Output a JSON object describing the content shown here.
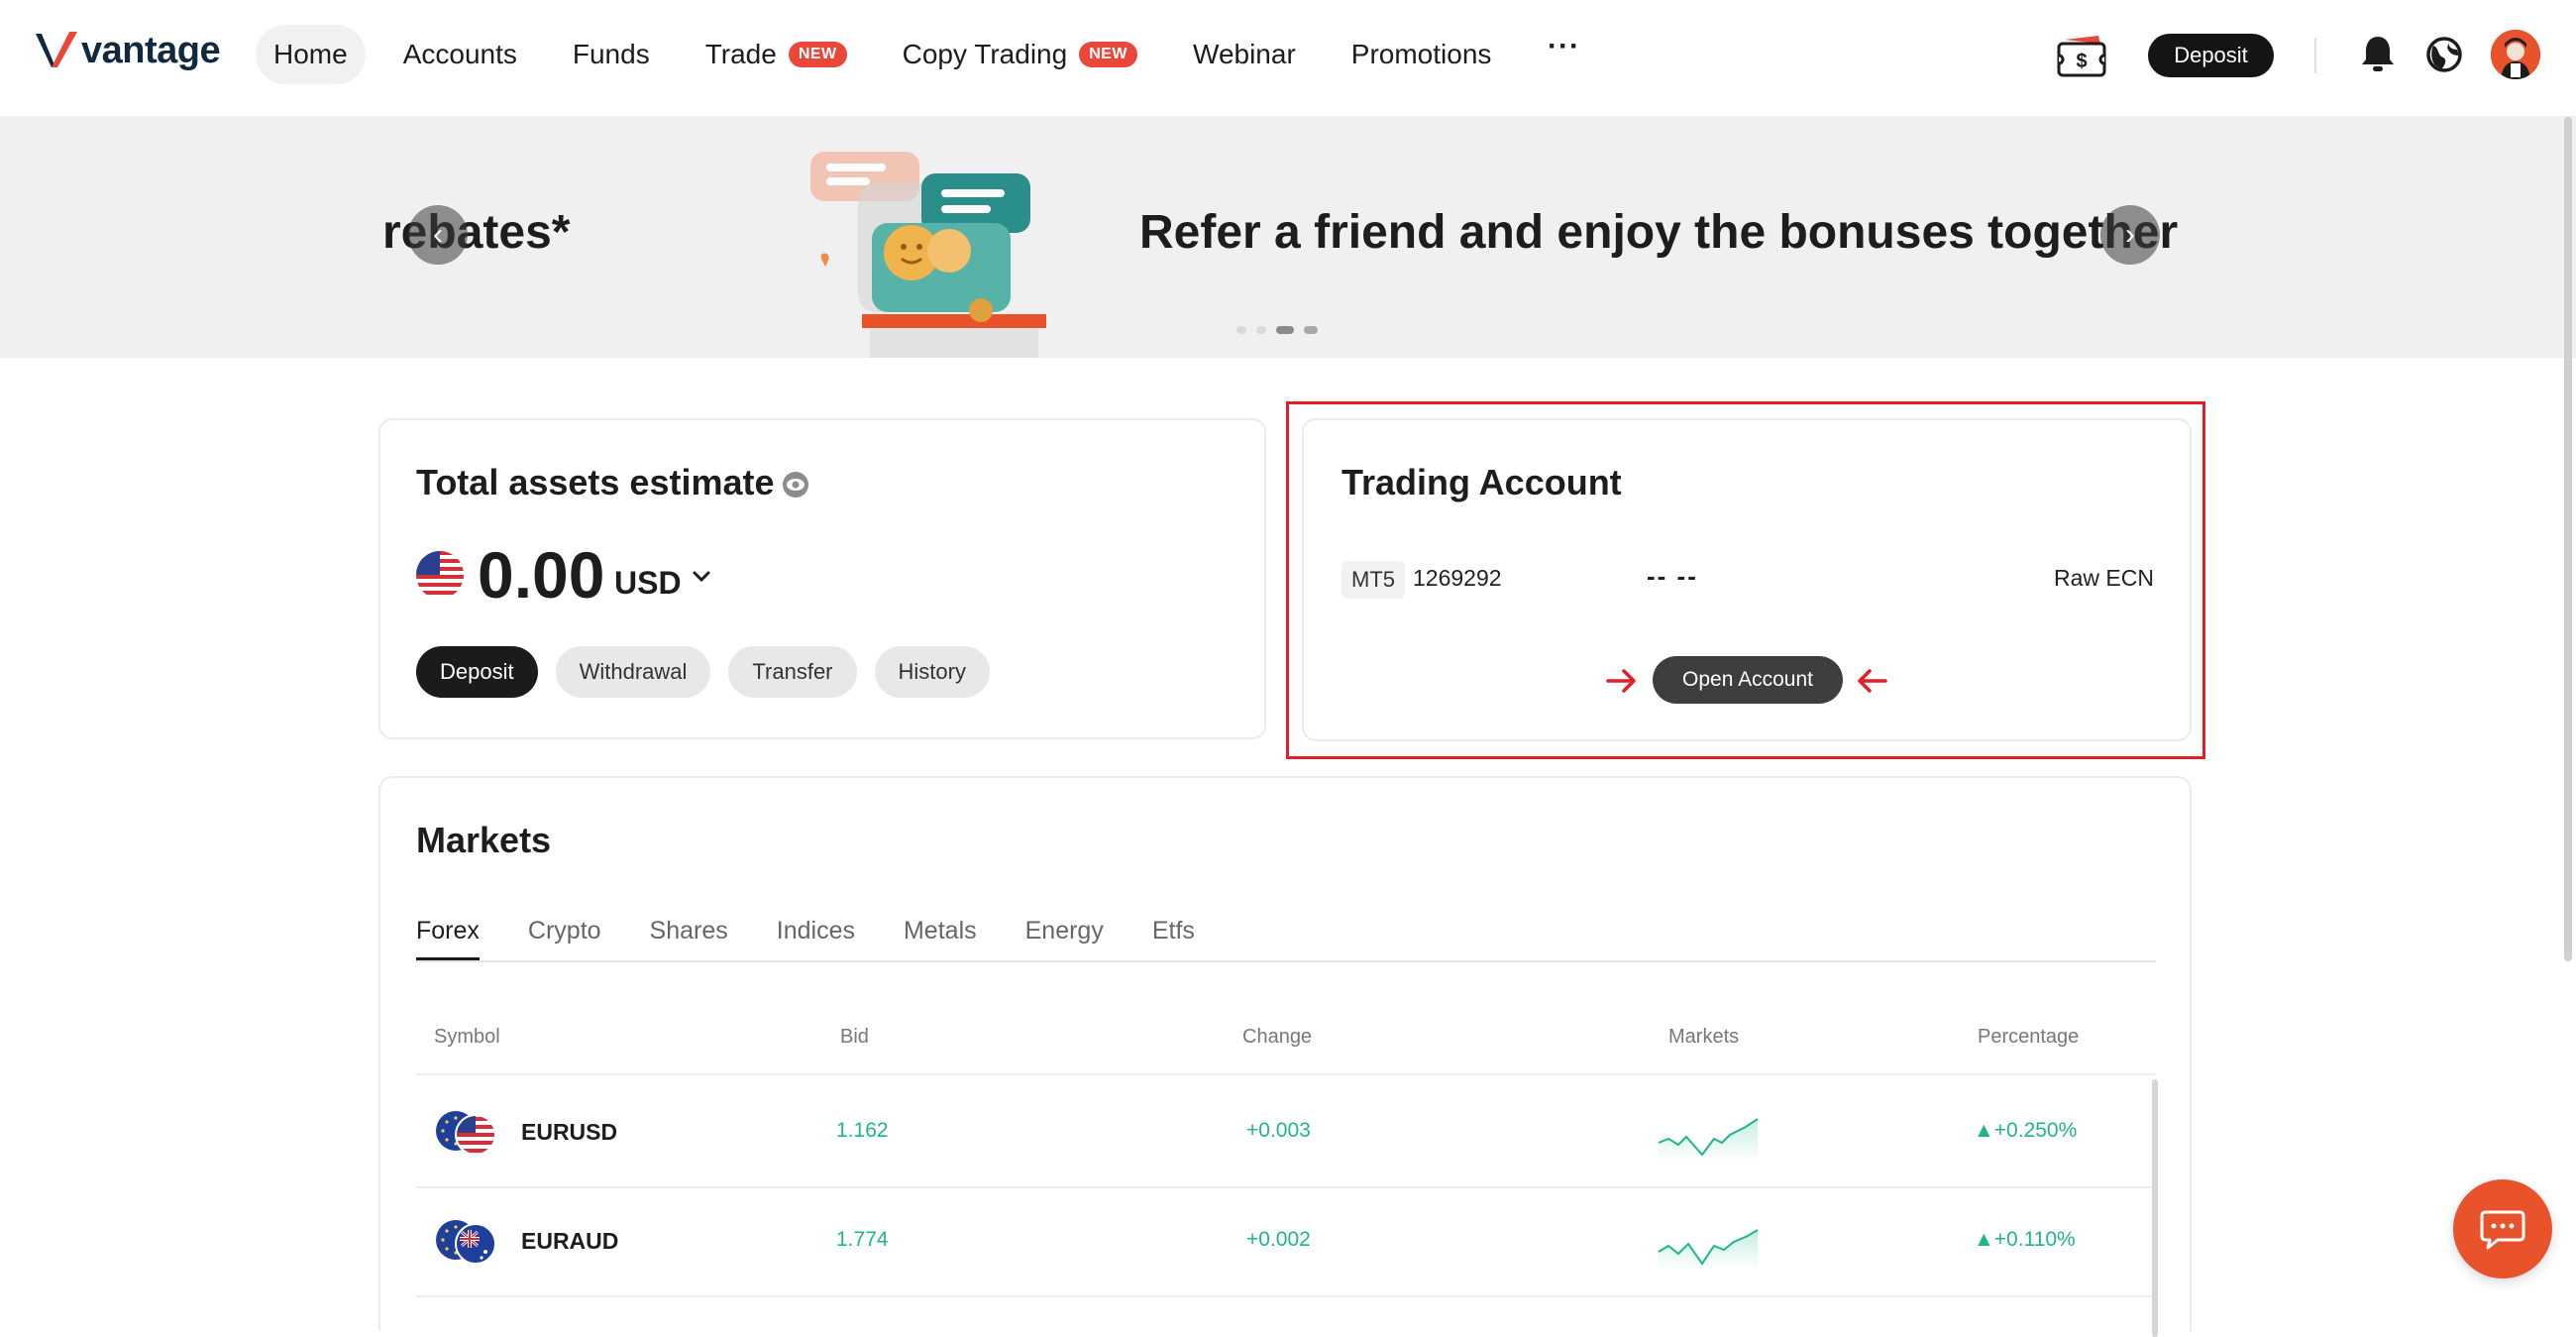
{
  "brand": {
    "name": "vantage",
    "accent": "#e8473a",
    "logo_color": "#11293f"
  },
  "nav": {
    "items": [
      {
        "label": "Home",
        "active": true
      },
      {
        "label": "Accounts"
      },
      {
        "label": "Funds"
      },
      {
        "label": "Trade",
        "badge": "NEW"
      },
      {
        "label": "Copy Trading",
        "badge": "NEW"
      },
      {
        "label": "Webinar"
      },
      {
        "label": "Promotions"
      }
    ],
    "more": "···",
    "deposit_label": "Deposit"
  },
  "banner": {
    "left_text": "rebates*",
    "main_text": "Refer a friend and enjoy the bonuses together",
    "dots": 4,
    "active_dot": 3
  },
  "assets": {
    "title": "Total assets estimate",
    "amount": "0.00",
    "currency": "USD",
    "buttons": [
      "Deposit",
      "Withdrawal",
      "Transfer",
      "History"
    ]
  },
  "trading_account": {
    "title": "Trading Account",
    "platform": "MT5",
    "account_number": "1269292",
    "values": "-- --",
    "account_type": "Raw ECN",
    "open_label": "Open Account",
    "highlight_color": "#e41e26"
  },
  "markets": {
    "title": "Markets",
    "tabs": [
      "Forex",
      "Crypto",
      "Shares",
      "Indices",
      "Metals",
      "Energy",
      "Etfs"
    ],
    "active_tab": "Forex",
    "columns": [
      "Symbol",
      "Bid",
      "Change",
      "Markets",
      "Percentage"
    ],
    "rows": [
      {
        "symbol": "EURUSD",
        "bid": "1.162",
        "change": "+0.003",
        "percentage": "+0.250%"
      },
      {
        "symbol": "EURAUD",
        "bid": "1.774",
        "change": "+0.002",
        "percentage": "+0.110%"
      }
    ],
    "positive_color": "#1fb58c"
  },
  "chat": {
    "icon": "chat-icon",
    "color": "#e9532b"
  }
}
